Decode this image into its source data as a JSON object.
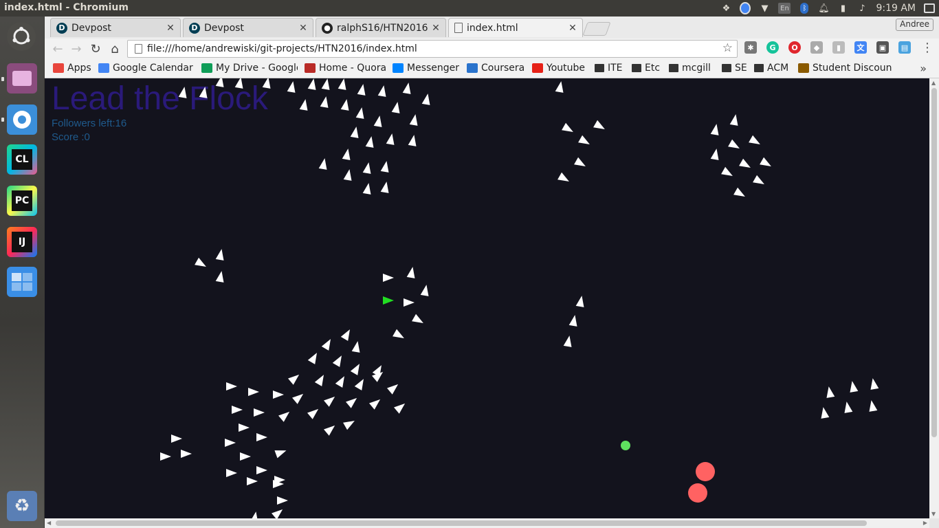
{
  "window_title": "index.html - Chromium",
  "tray": {
    "lang": "En",
    "clock": "9:19 AM",
    "user": "Andree"
  },
  "tabs": [
    {
      "label": "Devpost",
      "icon": "devpost-icon"
    },
    {
      "label": "Devpost",
      "icon": "devpost-icon"
    },
    {
      "label": "ralphS16/HTN2016",
      "icon": "github-icon"
    },
    {
      "label": "index.html",
      "icon": "page-icon"
    }
  ],
  "address": {
    "url": "file:///home/andrewiski/git-projects/HTN2016/index.html"
  },
  "bookmarks": [
    {
      "label": "Apps",
      "icon": "apps-icon",
      "color": "#e8453c"
    },
    {
      "label": "Google Calendar",
      "icon": "calendar-icon",
      "color": "#4285f4"
    },
    {
      "label": "My Drive - Google",
      "icon": "drive-icon",
      "color": "#0f9d58"
    },
    {
      "label": "Home - Quora",
      "icon": "quora-icon",
      "color": "#b92b27"
    },
    {
      "label": "Messenger",
      "icon": "messenger-icon",
      "color": "#0084ff"
    },
    {
      "label": "Coursera",
      "icon": "coursera-icon",
      "color": "#2a73cc"
    },
    {
      "label": "Youtube",
      "icon": "youtube-icon",
      "color": "#e62117"
    },
    {
      "label": "ITE",
      "icon": "folder-icon"
    },
    {
      "label": "Etc",
      "icon": "folder-icon"
    },
    {
      "label": "mcgill",
      "icon": "folder-icon"
    },
    {
      "label": "SE",
      "icon": "folder-icon"
    },
    {
      "label": "ACM",
      "icon": "folder-icon"
    },
    {
      "label": "Student Discoun",
      "icon": "studentdiscount-icon",
      "color": "#8a5a00"
    }
  ],
  "game": {
    "title": "Lead the Flock",
    "followers": "Followers left:16",
    "score": "Score :0",
    "colors": {
      "background": "#13131d",
      "follower": "#ffffff",
      "leader": "#22dd22",
      "pickup": "#5fe05f",
      "enemy": "#ff6262"
    }
  },
  "launcher": [
    {
      "name": "ubuntu-dash-icon"
    },
    {
      "name": "files-icon"
    },
    {
      "name": "chromium-icon"
    },
    {
      "name": "clion-icon",
      "label": "CL"
    },
    {
      "name": "pycharm-icon",
      "label": "PC"
    },
    {
      "name": "intellij-icon",
      "label": "IJ"
    },
    {
      "name": "workspace-switcher-icon"
    },
    {
      "name": "trash-icon"
    }
  ]
}
